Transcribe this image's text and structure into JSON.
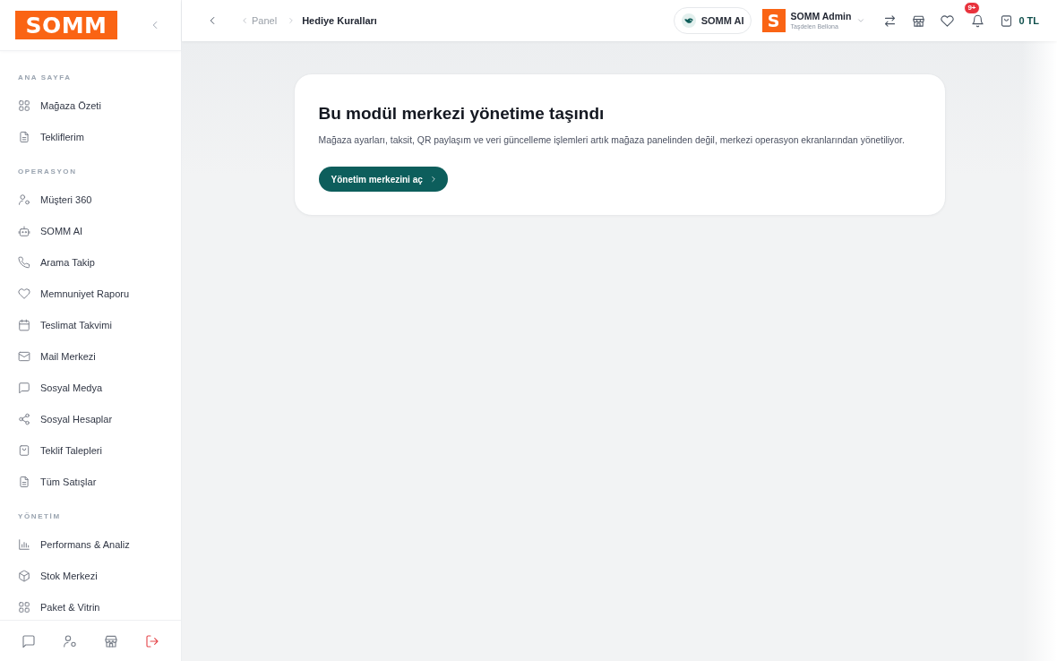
{
  "sidebar": {
    "logo": "SOMM",
    "sections": [
      {
        "title": "ANA SAYFA",
        "items": [
          {
            "label": "Mağaza Özeti",
            "selected": false
          },
          {
            "label": "Tekliflerim",
            "selected": false
          }
        ]
      },
      {
        "title": "OPERASYON",
        "items": [
          {
            "label": "Müşteri 360",
            "selected": false
          },
          {
            "label": "SOMM AI",
            "selected": false
          },
          {
            "label": "Arama Takip",
            "selected": false
          },
          {
            "label": "Memnuniyet Raporu",
            "selected": false
          },
          {
            "label": "Teslimat Takvimi",
            "selected": false
          },
          {
            "label": "Mail Merkezi",
            "selected": false
          },
          {
            "label": "Sosyal Medya",
            "selected": false
          },
          {
            "label": "Sosyal Hesaplar",
            "selected": false
          },
          {
            "label": "Teklif Talepleri",
            "selected": false
          },
          {
            "label": "Tüm Satışlar",
            "selected": false
          }
        ]
      },
      {
        "title": "YÖNETİM",
        "items": [
          {
            "label": "Performans & Analiz",
            "selected": false
          },
          {
            "label": "Stok Merkezi",
            "selected": false
          },
          {
            "label": "Paket & Vitrin",
            "selected": false
          }
        ]
      }
    ]
  },
  "topbar": {
    "breadcrumb": [
      {
        "label": "Panel"
      },
      {
        "label": "Hediye Kuralları"
      }
    ],
    "assistant": {
      "label": "SOMM AI"
    },
    "account": {
      "avatar": "S",
      "name": "SOMM Admin",
      "subtitle": "Taşdelen Bellona"
    },
    "notifications": {
      "badge": "9+"
    },
    "cart": {
      "total": "0 TL"
    }
  },
  "notice": {
    "title": "Bu modül merkezi yönetime taşındı",
    "text": "Mağaza ayarları, taksit, QR paylaşım ve veri güncelleme işlemleri artık mağaza panelinden değil, merkezi operasyon ekranlarından yönetiliyor.",
    "button": "Yönetim merkezini aç"
  }
}
